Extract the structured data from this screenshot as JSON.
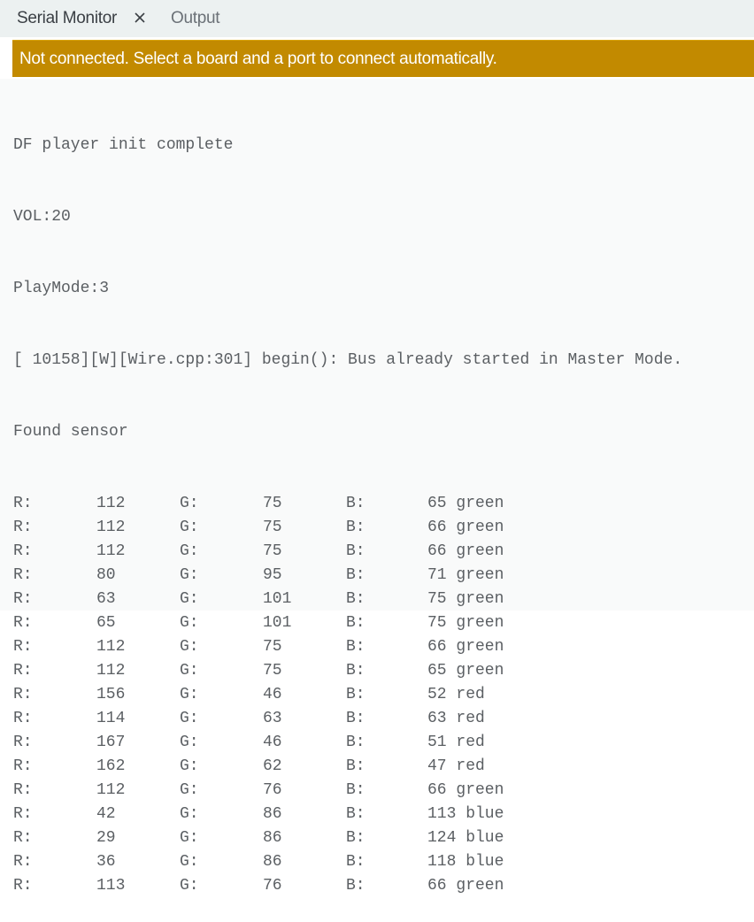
{
  "tabs": {
    "serial_monitor": "Serial Monitor",
    "output": "Output",
    "close_icon": "close-icon"
  },
  "banner": {
    "message": "Not connected. Select a board and a port to connect automatically.",
    "color": "#c28a00"
  },
  "console": {
    "header_lines": [
      "DF player init complete",
      "VOL:20",
      "PlayMode:3",
      "[ 10158][W][Wire.cpp:301] begin(): Bus already started in Master Mode.",
      "Found sensor"
    ],
    "rows": [
      {
        "r_label": "R:",
        "r": "112",
        "g_label": "G:",
        "g": "75",
        "b_label": "B:",
        "b": "65 green"
      },
      {
        "r_label": "R:",
        "r": "112",
        "g_label": "G:",
        "g": "75",
        "b_label": "B:",
        "b": "66 green"
      },
      {
        "r_label": "R:",
        "r": "112",
        "g_label": "G:",
        "g": "75",
        "b_label": "B:",
        "b": "66 green"
      },
      {
        "r_label": "R:",
        "r": "80",
        "g_label": "G:",
        "g": "95",
        "b_label": "B:",
        "b": "71 green"
      },
      {
        "r_label": "R:",
        "r": "63",
        "g_label": "G:",
        "g": "101",
        "b_label": "B:",
        "b": "75 green"
      },
      {
        "r_label": "R:",
        "r": "65",
        "g_label": "G:",
        "g": "101",
        "b_label": "B:",
        "b": "75 green"
      },
      {
        "r_label": "R:",
        "r": "112",
        "g_label": "G:",
        "g": "75",
        "b_label": "B:",
        "b": "66 green"
      },
      {
        "r_label": "R:",
        "r": "112",
        "g_label": "G:",
        "g": "75",
        "b_label": "B:",
        "b": "65 green"
      },
      {
        "r_label": "R:",
        "r": "156",
        "g_label": "G:",
        "g": "46",
        "b_label": "B:",
        "b": "52 red"
      },
      {
        "r_label": "R:",
        "r": "114",
        "g_label": "G:",
        "g": "63",
        "b_label": "B:",
        "b": "63 red"
      },
      {
        "r_label": "R:",
        "r": "167",
        "g_label": "G:",
        "g": "46",
        "b_label": "B:",
        "b": "51 red"
      },
      {
        "r_label": "R:",
        "r": "162",
        "g_label": "G:",
        "g": "62",
        "b_label": "B:",
        "b": "47 red"
      },
      {
        "r_label": "R:",
        "r": "112",
        "g_label": "G:",
        "g": "76",
        "b_label": "B:",
        "b": "66 green"
      },
      {
        "r_label": "R:",
        "r": "42",
        "g_label": "G:",
        "g": "86",
        "b_label": "B:",
        "b": "113 blue"
      },
      {
        "r_label": "R:",
        "r": "29",
        "g_label": "G:",
        "g": "86",
        "b_label": "B:",
        "b": "124 blue"
      },
      {
        "r_label": "R:",
        "r": "36",
        "g_label": "G:",
        "g": "86",
        "b_label": "B:",
        "b": "118 blue"
      },
      {
        "r_label": "R:",
        "r": "113",
        "g_label": "G:",
        "g": "76",
        "b_label": "B:",
        "b": "66 green"
      }
    ]
  }
}
